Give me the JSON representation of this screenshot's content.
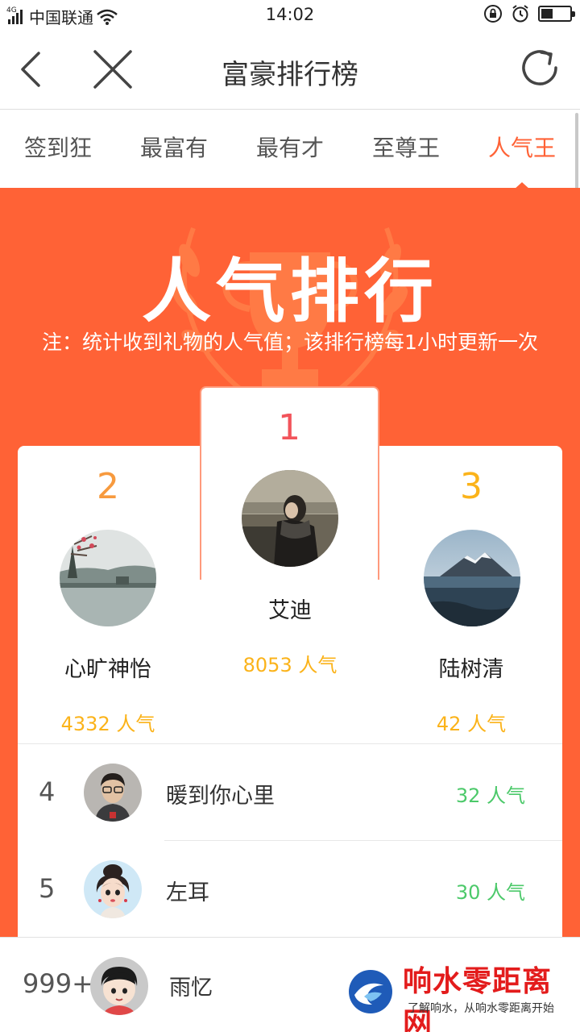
{
  "status_bar": {
    "network": "4G",
    "carrier": "中国联通",
    "time": "14:02"
  },
  "nav": {
    "title": "富豪排行榜"
  },
  "tabs": [
    {
      "label": "签到狂",
      "active": false
    },
    {
      "label": "最富有",
      "active": false
    },
    {
      "label": "最有才",
      "active": false
    },
    {
      "label": "至尊王",
      "active": false
    },
    {
      "label": "人气王",
      "active": true
    }
  ],
  "banner": {
    "title": "人气排行",
    "note": "注：统计收到礼物的人气值；该排行榜每1小时更新一次"
  },
  "podium": {
    "first": {
      "rank": "1",
      "name": "艾迪",
      "score": "8053  人气"
    },
    "second": {
      "rank": "2",
      "name": "心旷神怡",
      "score": "4332  人气"
    },
    "third": {
      "rank": "3",
      "name": "陆树清",
      "score": "42  人气"
    }
  },
  "list": [
    {
      "rank": "4",
      "name": "暖到你心里",
      "score": "32 人气"
    },
    {
      "rank": "5",
      "name": "左耳",
      "score": "30 人气"
    }
  ],
  "me": {
    "rank": "999+",
    "name": "雨忆"
  },
  "watermark": {
    "title": "响水零距离网",
    "subtitle": "了解响水，从响水零距离开始"
  },
  "colors": {
    "accent": "#ff6236",
    "first_rank": "#f2545b",
    "second_rank": "#f79a3e",
    "third_rank": "#fbb31a",
    "score_gold": "#fbb31a",
    "score_green": "#4cc96a"
  }
}
